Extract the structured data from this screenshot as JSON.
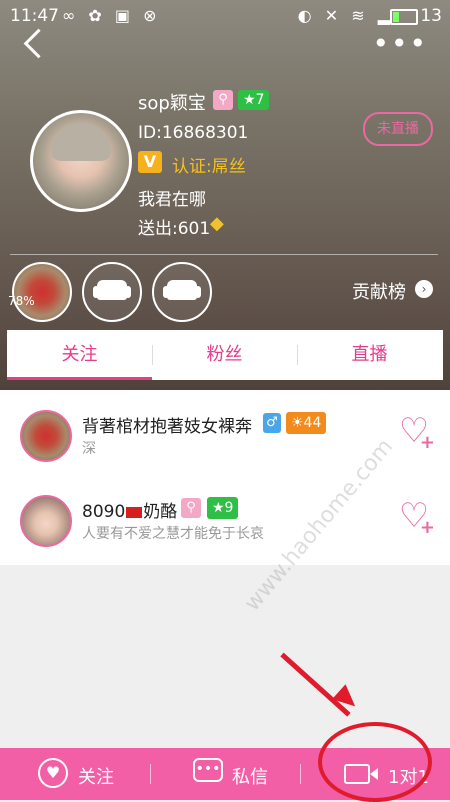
{
  "statusbar": {
    "time": "11:47",
    "battery": "13"
  },
  "profile": {
    "name": "sop颖宝",
    "level": "★7",
    "id": "ID:16868301",
    "verify_letter": "V",
    "verify_text": "认证:屌丝",
    "signature": "我君在哪",
    "sent": "送出:601",
    "live_status": "未直播"
  },
  "gifts": {
    "progress": "78%"
  },
  "rank_label": "贡献榜",
  "tabs": [
    {
      "label": "关注"
    },
    {
      "label": "粉丝"
    },
    {
      "label": "直播"
    }
  ],
  "list": [
    {
      "name": "背著棺材抱著妓女裸奔",
      "sub": "深",
      "gender": "♂",
      "level": "☀44"
    },
    {
      "name_pre": "8090",
      "name_post": "奶酪",
      "sub": "人要有不爱之慧才能免于长哀",
      "level": "★9"
    }
  ],
  "watermark": "www.haohome.com",
  "bottom": {
    "follow": "关注",
    "message": "私信",
    "video": "1对1"
  },
  "colors": {
    "accent": "#e63c8c",
    "bottom_bar": "#f25fa6",
    "level_green": "#2fbf45",
    "annotation_red": "#e01b2b"
  }
}
